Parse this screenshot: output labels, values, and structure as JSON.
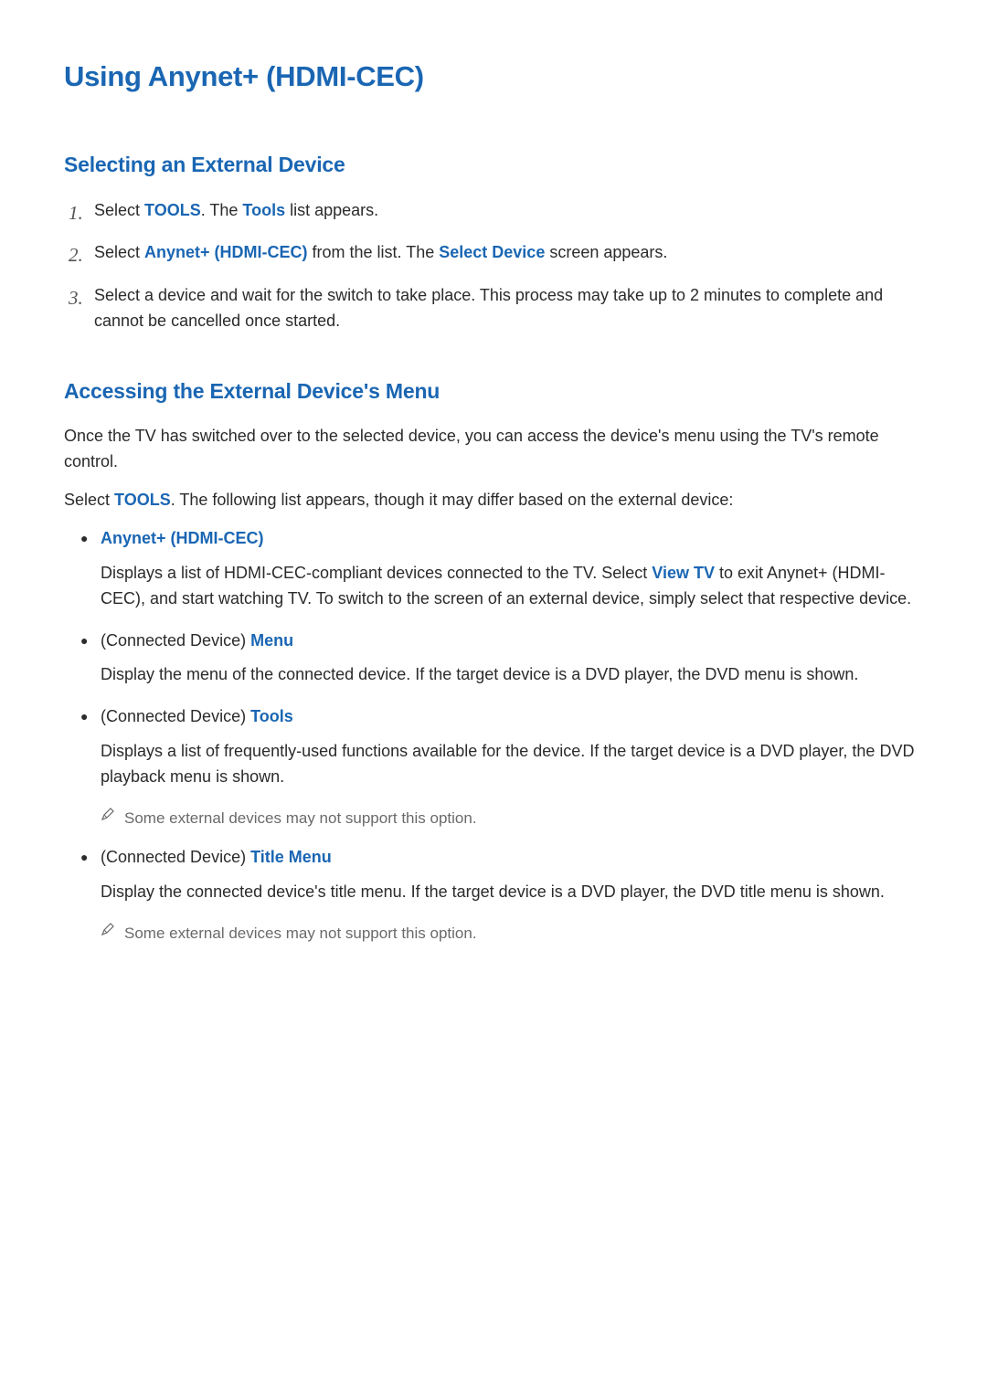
{
  "title": "Using Anynet+ (HDMI-CEC)",
  "section1": {
    "heading": "Selecting an External Device",
    "steps": [
      {
        "num": "1.",
        "t1": "Select ",
        "hl1": "TOOLS",
        "t2": ". The ",
        "hl2": "Tools",
        "t3": " list appears."
      },
      {
        "num": "2.",
        "t1": "Select ",
        "hl1": "Anynet+ (HDMI-CEC)",
        "t2": " from the list. The ",
        "hl2": "Select Device",
        "t3": " screen appears."
      },
      {
        "num": "3.",
        "t1": "Select a device and wait for the switch to take place. This process may take up to 2 minutes to complete and cannot be cancelled once started."
      }
    ]
  },
  "section2": {
    "heading": "Accessing the External Device's Menu",
    "intro1": "Once the TV has switched over to the selected device, you can access the device's menu using the TV's remote control.",
    "intro2_a": "Select ",
    "intro2_hl": "TOOLS",
    "intro2_b": ". The following list appears, though it may differ based on the external device:",
    "items": [
      {
        "title_plain": "",
        "title_hl": "Anynet+ (HDMI-CEC)",
        "desc_a": "Displays a list of HDMI-CEC-compliant devices connected to the TV. Select ",
        "desc_hl": "View TV",
        "desc_b": " to exit Anynet+ (HDMI-CEC), and start watching TV. To switch to the screen of an external device, simply select that respective device.",
        "note": ""
      },
      {
        "title_plain": "(Connected Device) ",
        "title_hl": "Menu",
        "desc_a": "Display the menu of the connected device. If the target device is a DVD player, the DVD menu is shown.",
        "desc_hl": "",
        "desc_b": "",
        "note": ""
      },
      {
        "title_plain": "(Connected Device) ",
        "title_hl": "Tools",
        "desc_a": "Displays a list of frequently-used functions available for the device. If the target device is a DVD player, the DVD playback menu is shown.",
        "desc_hl": "",
        "desc_b": "",
        "note": "Some external devices may not support this option."
      },
      {
        "title_plain": "(Connected Device) ",
        "title_hl": "Title Menu",
        "desc_a": "Display the connected device's title menu. If the target device is a DVD player, the DVD title menu is shown.",
        "desc_hl": "",
        "desc_b": "",
        "note": "Some external devices may not support this option."
      }
    ]
  }
}
